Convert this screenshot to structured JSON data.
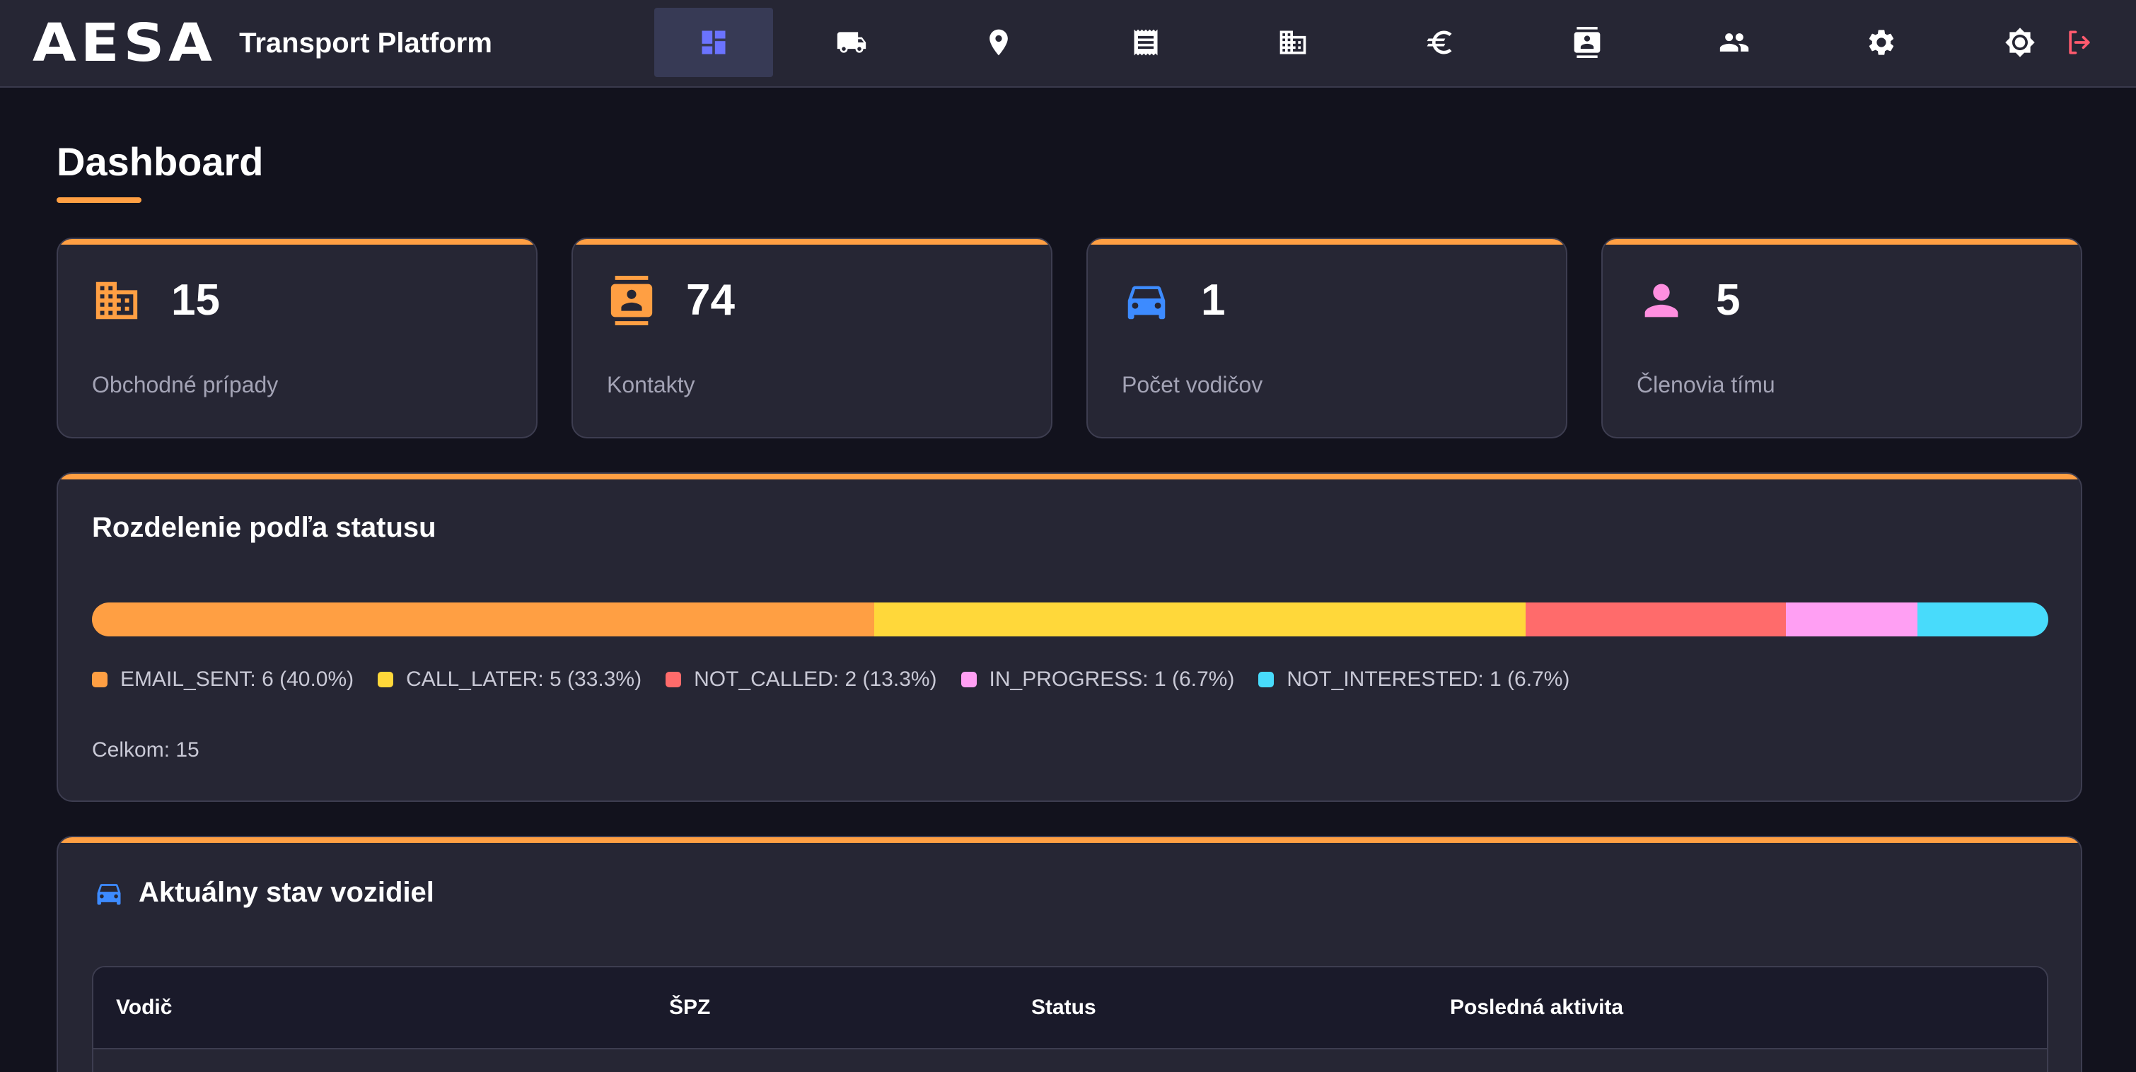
{
  "app": {
    "logo": "AESA",
    "title": "Transport Platform"
  },
  "nav": {
    "items": [
      {
        "icon": "dashboard-icon",
        "active": true
      },
      {
        "icon": "truck-icon",
        "active": false
      },
      {
        "icon": "location-pin-icon",
        "active": false
      },
      {
        "icon": "receipt-icon",
        "active": false
      },
      {
        "icon": "building-icon",
        "active": false
      },
      {
        "icon": "euro-icon",
        "active": false
      },
      {
        "icon": "contact-card-icon",
        "active": false
      },
      {
        "icon": "people-icon",
        "active": false
      },
      {
        "icon": "gear-icon",
        "active": false
      }
    ],
    "right": [
      "brightness-icon",
      "logout-icon"
    ]
  },
  "page": {
    "title": "Dashboard"
  },
  "stats": [
    {
      "icon": "building-icon",
      "value": "15",
      "label": "Obchodné prípady",
      "color": "#ff9f43"
    },
    {
      "icon": "contact-card-icon",
      "value": "74",
      "label": "Kontakty",
      "color": "#ff9f43"
    },
    {
      "icon": "car-icon",
      "value": "1",
      "label": "Počet vodičov",
      "color": "#3d8bff"
    },
    {
      "icon": "person-icon",
      "value": "5",
      "label": "Členovia tímu",
      "color": "#ff8fe0"
    }
  ],
  "status": {
    "title": "Rozdelenie podľa statusu",
    "segments": [
      {
        "label": "EMAIL_SENT: 6 (40.0%)",
        "fraction": 0.4,
        "color": "#ff9f43"
      },
      {
        "label": "CALL_LATER: 5 (33.3%)",
        "fraction": 0.333,
        "color": "#ffd83a"
      },
      {
        "label": "NOT_CALLED: 2 (13.3%)",
        "fraction": 0.133,
        "color": "#ff6b6b"
      },
      {
        "label": "IN_PROGRESS: 1 (6.7%)",
        "fraction": 0.067,
        "color": "#ff9ff3"
      },
      {
        "label": "NOT_INTERESTED: 1 (6.7%)",
        "fraction": 0.067,
        "color": "#48dbfb"
      }
    ],
    "total": "Celkom: 15"
  },
  "vehicles": {
    "title": "Aktuálny stav vozidiel",
    "columns": [
      "Vodič",
      "ŠPZ",
      "Status",
      "Posledná aktivita"
    ]
  },
  "colors": {
    "accent": "#ff9f43",
    "background": "#12121d",
    "card": "#262634"
  }
}
